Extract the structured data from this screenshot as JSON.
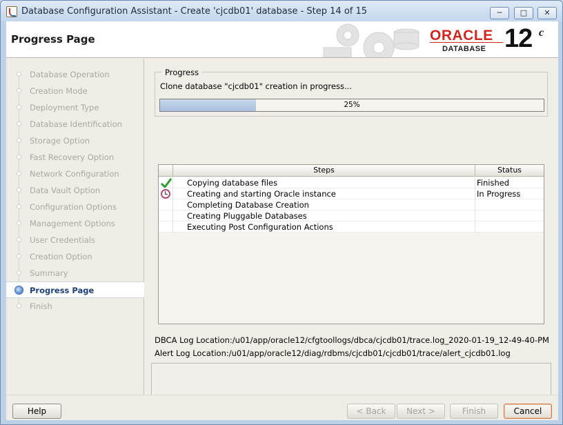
{
  "window": {
    "title": "Database Configuration Assistant - Create 'cjcdb01' database - Step 14 of 15"
  },
  "header": {
    "page_title": "Progress Page",
    "brand_name": "ORACLE",
    "brand_sub": "DATABASE",
    "version": "12",
    "version_suffix": "c"
  },
  "sidebar": {
    "items": [
      {
        "label": "Database Operation"
      },
      {
        "label": "Creation Mode"
      },
      {
        "label": "Deployment Type"
      },
      {
        "label": "Database Identification"
      },
      {
        "label": "Storage Option"
      },
      {
        "label": "Fast Recovery Option"
      },
      {
        "label": "Network Configuration"
      },
      {
        "label": "Data Vault Option"
      },
      {
        "label": "Configuration Options"
      },
      {
        "label": "Management Options"
      },
      {
        "label": "User Credentials"
      },
      {
        "label": "Creation Option"
      },
      {
        "label": "Summary"
      },
      {
        "label": "Progress Page",
        "active": true
      },
      {
        "label": "Finish"
      }
    ]
  },
  "progress": {
    "legend": "Progress",
    "message": "Clone database \"cjcdb01\" creation in progress...",
    "percent_label": "25%",
    "fraction": 0.25
  },
  "steps_table": {
    "headers": {
      "steps": "Steps",
      "status": "Status"
    },
    "rows": [
      {
        "step": "Copying database files",
        "status": "Finished",
        "icon": "check-icon"
      },
      {
        "step": "Creating and starting Oracle instance",
        "status": "In Progress",
        "icon": "clock-icon"
      },
      {
        "step": "Completing Database Creation",
        "status": "",
        "icon": ""
      },
      {
        "step": "Creating Pluggable Databases",
        "status": "",
        "icon": ""
      },
      {
        "step": "Executing Post Configuration Actions",
        "status": "",
        "icon": ""
      }
    ]
  },
  "logs": {
    "dbca": "DBCA Log Location:/u01/app/oracle12/cfgtoollogs/dbca/cjcdb01/trace.log_2020-01-19_12-49-40-PM",
    "alert": "Alert Log Location:/u01/app/oracle12/diag/rdbms/cjcdb01/cjcdb01/trace/alert_cjcdb01.log"
  },
  "footer": {
    "help": "Help",
    "back": "< Back",
    "next": "Next >",
    "finish": "Finish",
    "cancel": "Cancel"
  },
  "colors": {
    "accent": "#1d3f7a",
    "oracle_red": "#d0261f",
    "progress_fill": "#a8c0df",
    "check_green": "#2e9a2e"
  }
}
